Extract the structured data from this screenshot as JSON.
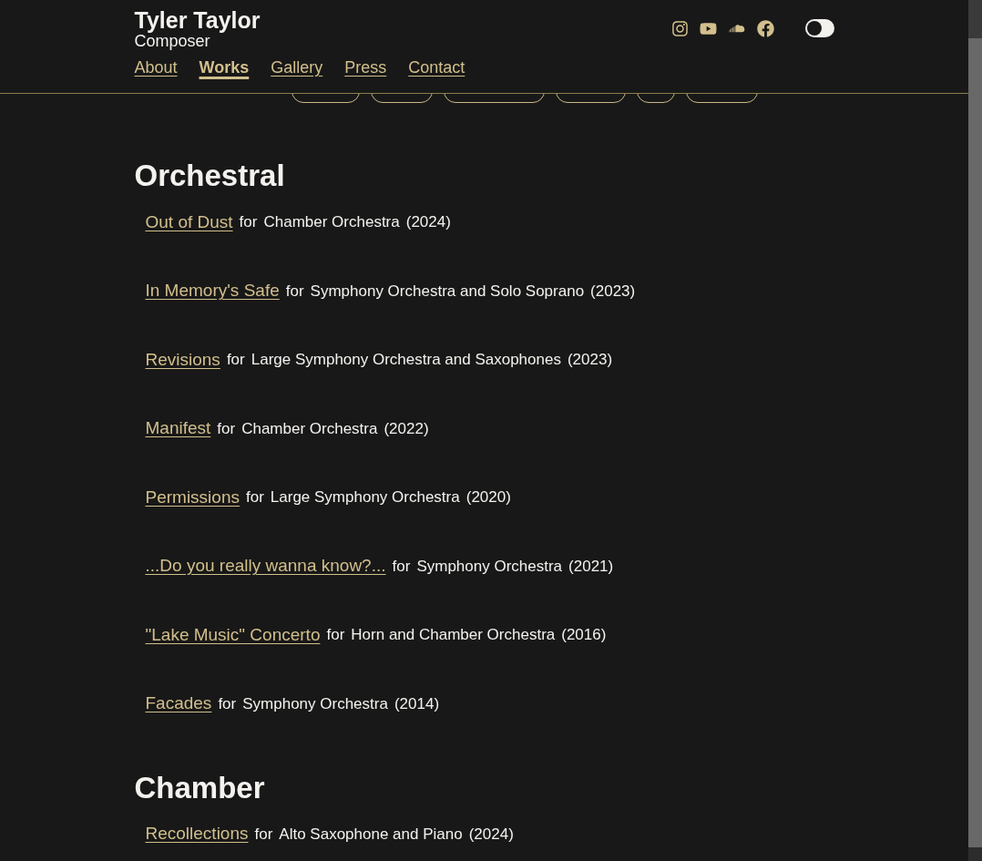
{
  "site": {
    "name": "Tyler Taylor",
    "subtitle": "Composer"
  },
  "nav": [
    {
      "label": "About",
      "selected": false
    },
    {
      "label": "Works",
      "selected": true
    },
    {
      "label": "Gallery",
      "selected": false
    },
    {
      "label": "Press",
      "selected": false
    },
    {
      "label": "Contact",
      "selected": false
    }
  ],
  "social": [
    {
      "kind": "instagram"
    },
    {
      "kind": "youtube"
    },
    {
      "kind": "soundcloud"
    },
    {
      "kind": "facebook"
    }
  ],
  "theme_toggle": {
    "on": false
  },
  "filters": [
    {
      "kind": "pill"
    },
    {
      "kind": "pill"
    },
    {
      "kind": "pill"
    },
    {
      "kind": "pill"
    },
    {
      "kind": "pill"
    },
    {
      "kind": "pill"
    }
  ],
  "sections": [
    {
      "title": "Orchestral",
      "works": [
        {
          "title": "Out of Dust",
          "for": "for",
          "instrumentation": "Chamber Orchestra",
          "year": "(2024)"
        },
        {
          "title": "In Memory's Safe",
          "for": "for",
          "instrumentation": "Symphony Orchestra and Solo Soprano",
          "year": "(2023)"
        },
        {
          "title": "Revisions",
          "for": "for",
          "instrumentation": "Large Symphony Orchestra and Saxophones",
          "year": "(2023)"
        },
        {
          "title": "Manifest",
          "for": "for",
          "instrumentation": "Chamber Orchestra",
          "year": "(2022)"
        },
        {
          "title": "Permissions",
          "for": "for",
          "instrumentation": "Large Symphony Orchestra",
          "year": "(2020)"
        },
        {
          "title": "...Do you really wanna know?...",
          "for": "for",
          "instrumentation": "Symphony Orchestra",
          "year": "(2021)"
        },
        {
          "title": "\"Lake Music\" Concerto",
          "for": "for",
          "instrumentation": "Horn and Chamber Orchestra",
          "year": "(2016)"
        },
        {
          "title": "Facades",
          "for": "for",
          "instrumentation": "Symphony Orchestra",
          "year": "(2014)"
        }
      ]
    },
    {
      "title": "Chamber",
      "works": [
        {
          "title": "Recollections",
          "for": "for",
          "instrumentation": "Alto Saxophone and Piano",
          "year": "(2024)"
        }
      ]
    }
  ]
}
